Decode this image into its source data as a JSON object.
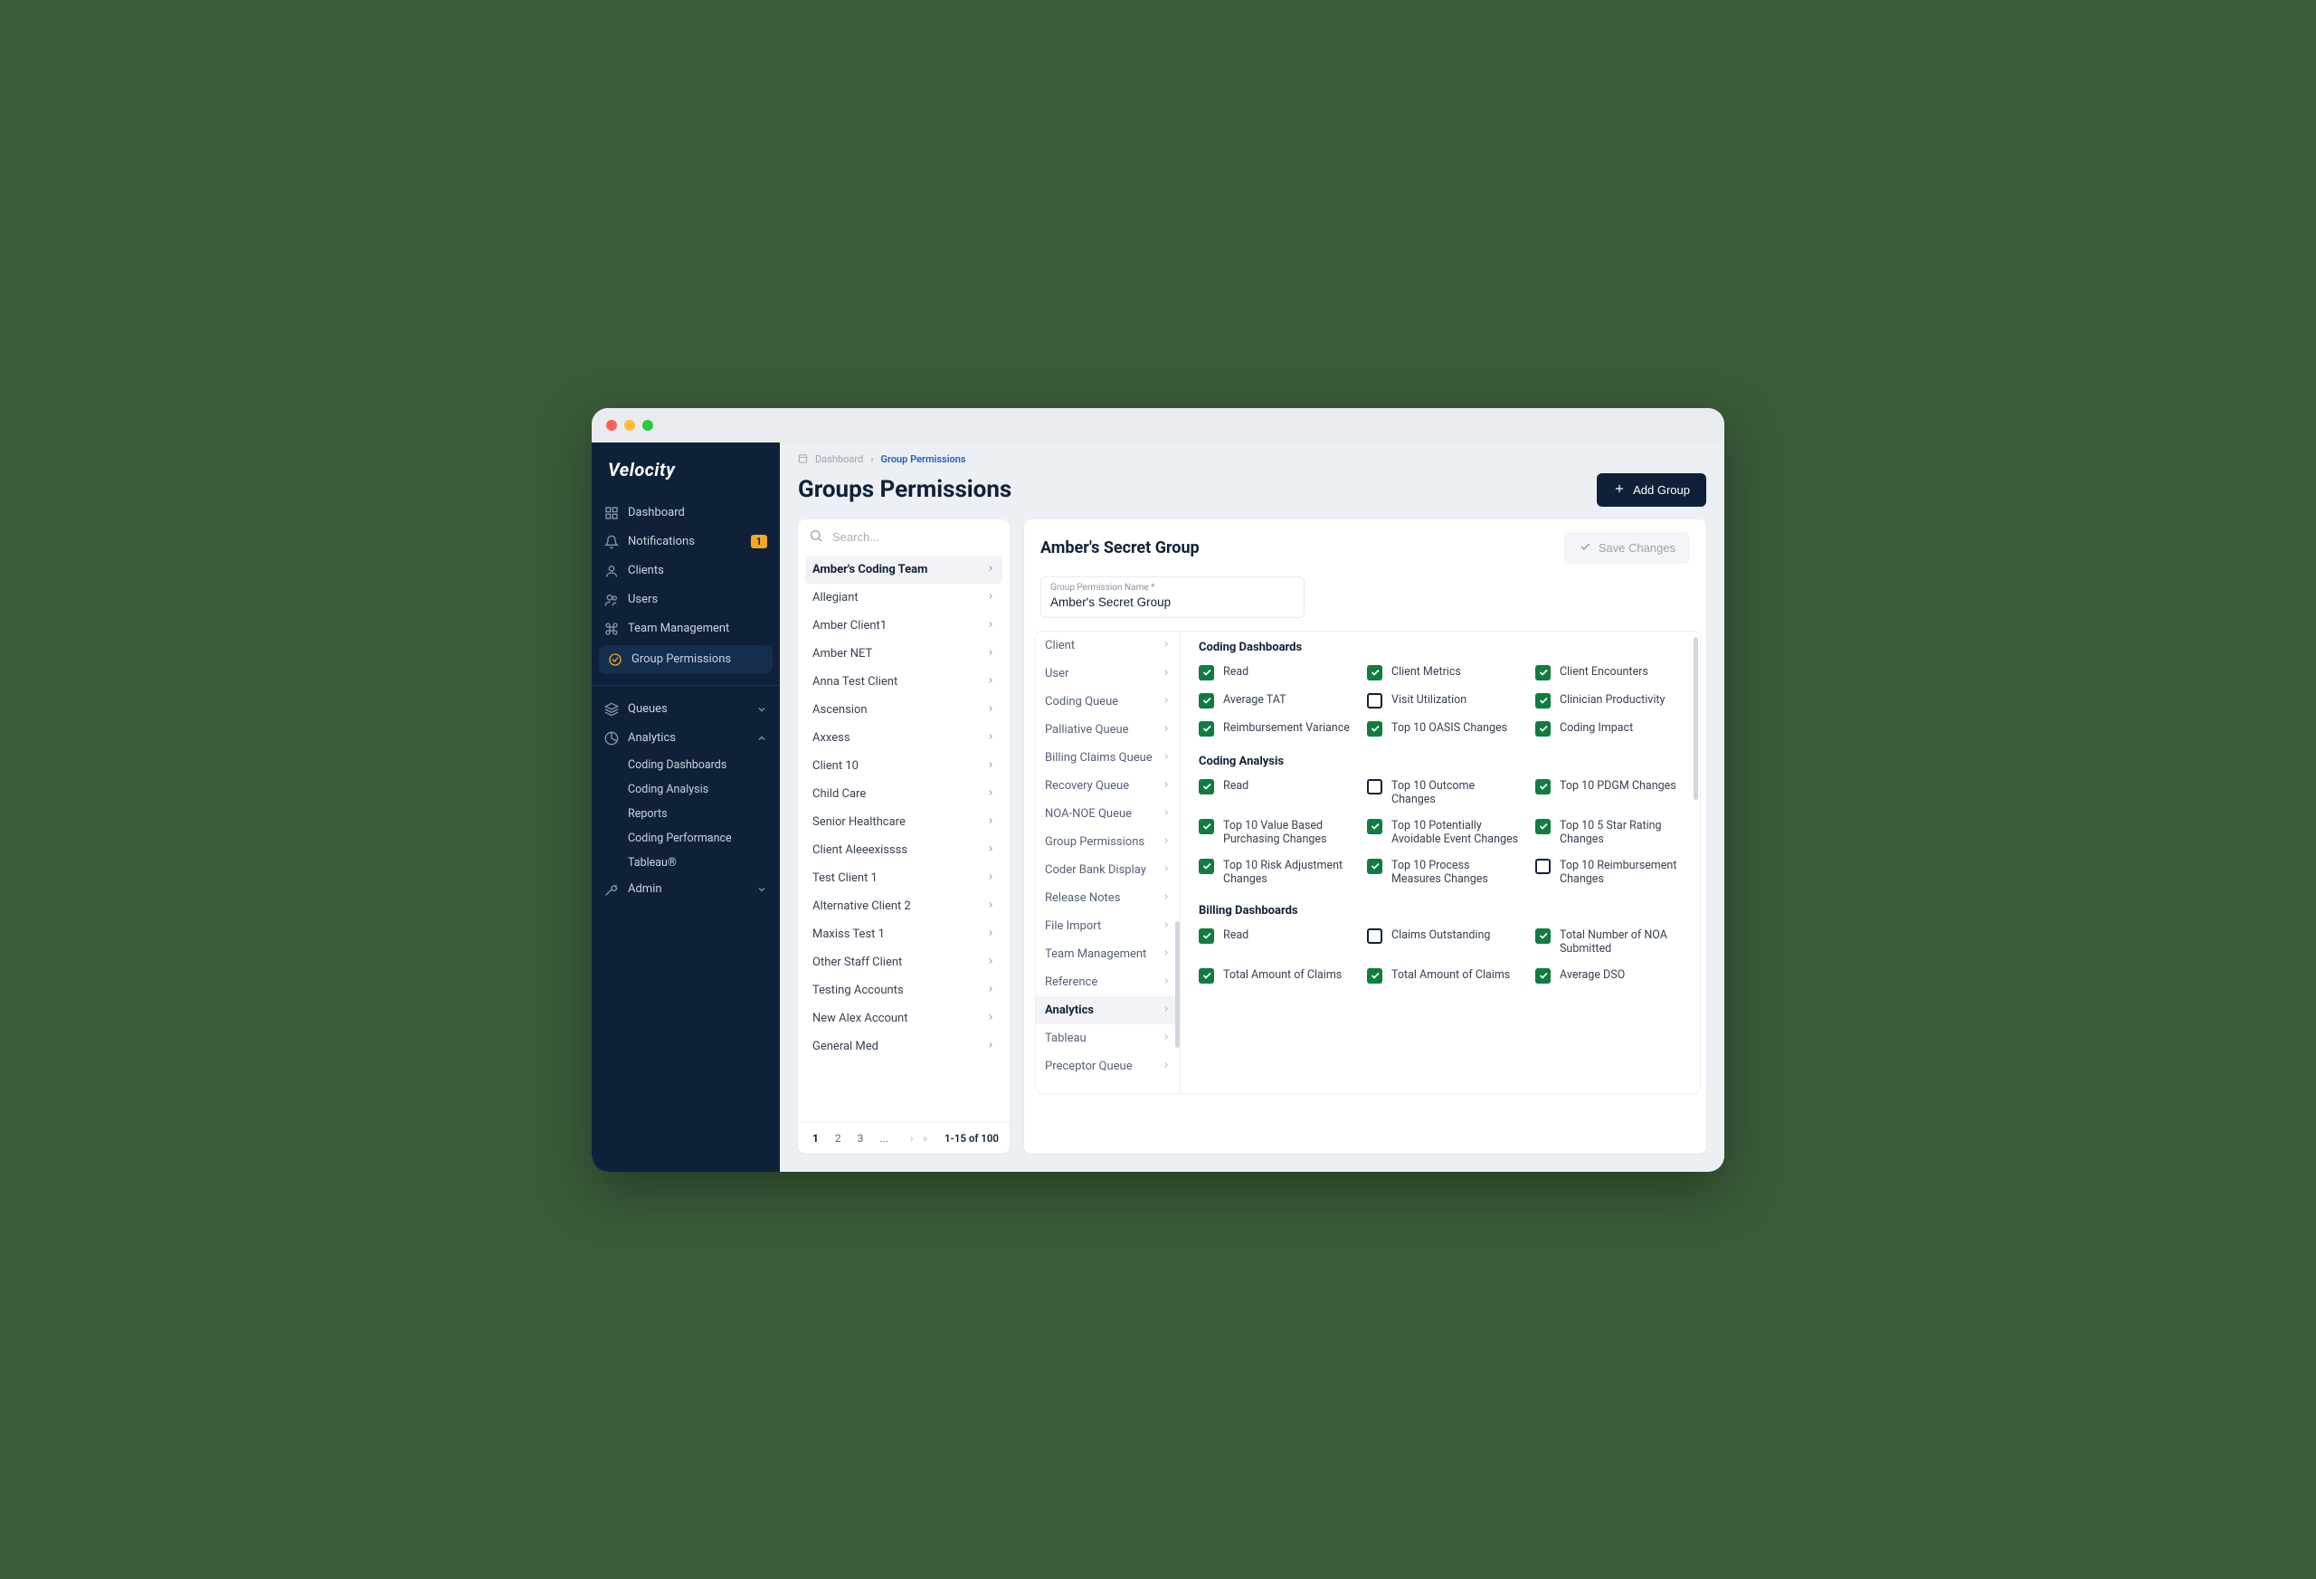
{
  "logo": "Velocity",
  "sidebar": {
    "items": [
      {
        "label": "Dashboard",
        "icon": "grid"
      },
      {
        "label": "Notifications",
        "icon": "bell",
        "badge": "1"
      },
      {
        "label": "Clients",
        "icon": "user"
      },
      {
        "label": "Users",
        "icon": "users"
      },
      {
        "label": "Team Management",
        "icon": "command"
      },
      {
        "label": "Group Permissions",
        "icon": "check-circle",
        "active": true
      }
    ],
    "collapsible": [
      {
        "label": "Queues",
        "icon": "layers",
        "expanded": false
      },
      {
        "label": "Analytics",
        "icon": "pie",
        "expanded": true,
        "children": [
          "Coding Dashboards",
          "Coding Analysis",
          "Reports",
          "Coding Performance",
          "Tableau®"
        ]
      },
      {
        "label": "Admin",
        "icon": "wrench",
        "expanded": false
      }
    ]
  },
  "breadcrumb": {
    "root": "Dashboard",
    "current": "Group Permissions"
  },
  "page_title": "Groups Permissions",
  "add_button": "Add Group",
  "search_placeholder": "Search...",
  "groups": [
    {
      "name": "Amber's Coding Team",
      "selected": true
    },
    {
      "name": "Allegiant"
    },
    {
      "name": "Amber Client1"
    },
    {
      "name": "Amber NET"
    },
    {
      "name": "Anna Test Client"
    },
    {
      "name": "Ascension"
    },
    {
      "name": "Axxess"
    },
    {
      "name": "Client 10"
    },
    {
      "name": "Child Care"
    },
    {
      "name": "Senior Healthcare"
    },
    {
      "name": "Client Aleeexissss"
    },
    {
      "name": "Test Client 1"
    },
    {
      "name": "Alternative Client 2"
    },
    {
      "name": "Maxiss Test 1"
    },
    {
      "name": "Other Staff Client"
    },
    {
      "name": "Testing Accounts"
    },
    {
      "name": "New Alex Account"
    },
    {
      "name": "General Med"
    }
  ],
  "pager": {
    "pages": [
      "1",
      "2",
      "3",
      "..."
    ],
    "info": "1-15 of 100"
  },
  "detail": {
    "title": "Amber's Secret Group",
    "save_label": "Save Changes",
    "name_label": "Group Permission Name *",
    "name_value": "Amber's Secret Group"
  },
  "categories": [
    "Client",
    "User",
    "Coding Queue",
    "Palliative Queue",
    "Billing Claims Queue",
    "Recovery Queue",
    "NOA-NOE Queue",
    "Group Permissions",
    "Coder Bank Display",
    "Release Notes",
    "File Import",
    "Team Management",
    "Reference",
    "Analytics",
    "Tableau",
    "Preceptor Queue"
  ],
  "categories_selected": "Analytics",
  "sections": [
    {
      "title": "Coding Dashboards",
      "items": [
        {
          "label": "Read",
          "checked": true
        },
        {
          "label": "Client Metrics",
          "checked": true
        },
        {
          "label": "Client Encounters",
          "checked": true
        },
        {
          "label": "Average TAT",
          "checked": true
        },
        {
          "label": "Visit Utilization",
          "checked": false
        },
        {
          "label": "Clinician Productivity",
          "checked": true
        },
        {
          "label": "Reimbursement Variance",
          "checked": true
        },
        {
          "label": "Top 10 OASIS Changes",
          "checked": true
        },
        {
          "label": "Coding Impact",
          "checked": true
        }
      ]
    },
    {
      "title": "Coding Analysis",
      "items": [
        {
          "label": "Read",
          "checked": true
        },
        {
          "label": "Top 10 Outcome Changes",
          "checked": false
        },
        {
          "label": "Top 10 PDGM Changes",
          "checked": true
        },
        {
          "label": "Top 10 Value Based Purchasing Changes",
          "checked": true
        },
        {
          "label": "Top 10 Potentially Avoidable Event Changes",
          "checked": true
        },
        {
          "label": "Top 10 5 Star Rating Changes",
          "checked": true
        },
        {
          "label": "Top 10 Risk Adjustment Changes",
          "checked": true
        },
        {
          "label": "Top 10 Process Measures Changes",
          "checked": true
        },
        {
          "label": "Top 10 Reimbursement Changes",
          "checked": false
        }
      ]
    },
    {
      "title": "Billing Dashboards",
      "items": [
        {
          "label": "Read",
          "checked": true
        },
        {
          "label": "Claims Outstanding",
          "checked": false
        },
        {
          "label": "Total Number of NOA Submitted",
          "checked": true
        },
        {
          "label": "Total Amount of Claims",
          "checked": true
        },
        {
          "label": "Total Amount of Claims",
          "checked": true
        },
        {
          "label": "Average DSO",
          "checked": true
        }
      ]
    }
  ]
}
